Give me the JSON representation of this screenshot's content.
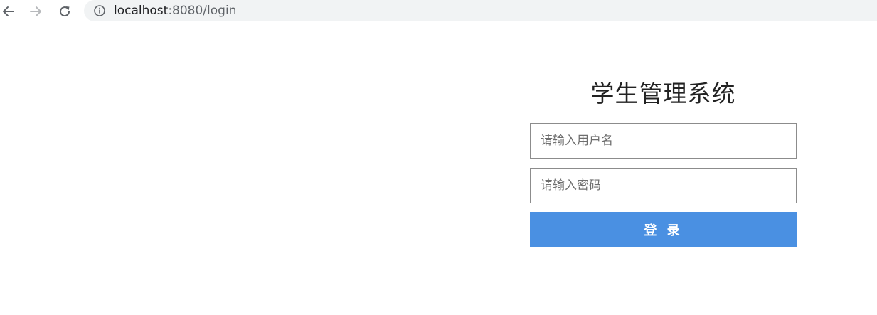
{
  "browser": {
    "url_host": "localhost",
    "url_path": ":8080/login",
    "icons": {
      "back": "arrow-left-icon",
      "forward": "arrow-right-icon",
      "reload": "reload-icon",
      "site_info": "info-icon"
    }
  },
  "login": {
    "title": "学生管理系统",
    "username_placeholder": "请输入用户名",
    "password_placeholder": "请输入密码",
    "submit_label": "登 录"
  },
  "colors": {
    "button_background": "#4a90e2",
    "button_text": "#ffffff",
    "input_border": "#8c8c8c"
  }
}
